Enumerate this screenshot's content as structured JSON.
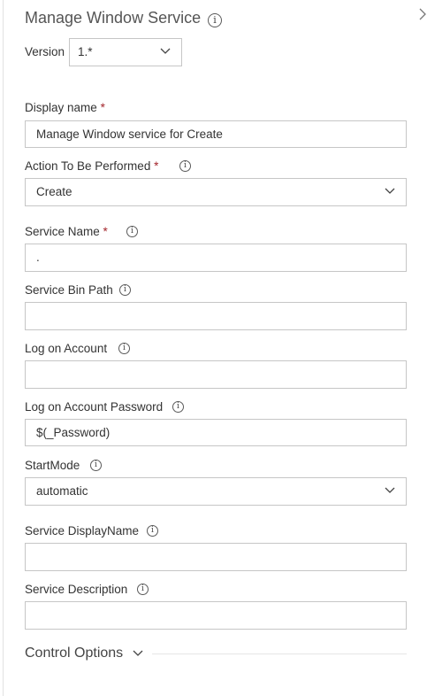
{
  "header": {
    "title": "Manage Window Service",
    "info_icon": "info-icon",
    "collapse_icon": "chevron-right-icon"
  },
  "version": {
    "label": "Version",
    "value": "1.*"
  },
  "fields": {
    "display_name": {
      "label": "Display name",
      "required_mark": "*",
      "value": "Manage Window service for Create"
    },
    "action": {
      "label": "Action To Be Performed",
      "required_mark": "*",
      "value": "Create"
    },
    "service_name": {
      "label": "Service Name",
      "required_mark": "*",
      "value": "."
    },
    "service_bin_path": {
      "label": "Service Bin Path",
      "value": ""
    },
    "log_on_account": {
      "label": "Log on Account",
      "value": ""
    },
    "log_on_password": {
      "label": "Log on Account Password",
      "value": "$(_Password)"
    },
    "start_mode": {
      "label": "StartMode",
      "value": "automatic"
    },
    "service_display_name": {
      "label": "Service DisplayName",
      "value": ""
    },
    "service_description": {
      "label": "Service Description",
      "value": ""
    }
  },
  "control_options": {
    "label": "Control Options"
  },
  "colors": {
    "required": "#a4262c",
    "border": "#c6c6c6",
    "text": "#333333"
  }
}
